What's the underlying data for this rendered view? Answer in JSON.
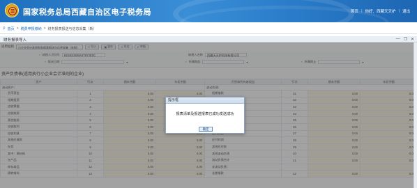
{
  "header": {
    "title": "国家税务总局西藏自治区电子税务局",
    "user_links": [
      "首页",
      "你好,",
      "西藏天天护",
      "退出"
    ]
  },
  "breadcrumb": {
    "home": "首页",
    "parent": "税费申报缴纳",
    "current": "财务报表报送与信息采集（新）"
  },
  "window": {
    "title": "财务报表导入",
    "controls": [
      "—",
      "❐",
      "✕"
    ]
  },
  "toolbar": {
    "period_label": "适用准则",
    "period_value": "小企业会计准则财务报表报送与信息采集（年报）",
    "buttons": [
      "导入",
      "暂存",
      "导出",
      "申报"
    ]
  },
  "form": {
    "taxpayer_id_label": "纳税人识别号",
    "taxpayer_id_value": "91540100MA6T8Y2E0C",
    "taxpayer_name_label": "纳税人名称",
    "taxpayer_name_value": "西藏天天护科技有限公司",
    "start_label": "报送日期",
    "start_value": "",
    "period_start_label": "所属期起",
    "period_start_value": "",
    "period_end_label": "所属期止",
    "period_end_value": ""
  },
  "section_title": "资产负债表(适用执行小企业会计准则的企业)",
  "table": {
    "headers": [
      "资产",
      "行次",
      "期末余额",
      "年初余额",
      "负债和所有者权益",
      "行次",
      "期末余额",
      "年初余额"
    ],
    "group_label": "流动资产：",
    "group_label_right": "流动负债：",
    "rows": [
      [
        "货币资金",
        "1",
        "0.00",
        "0.00",
        "短期借款",
        "31",
        "0.00",
        "0.00"
      ],
      [
        "短期投资",
        "2",
        "0.00",
        "0.00",
        "应付票据",
        "32",
        "0.00",
        "0.00"
      ],
      [
        "应收票据",
        "3",
        "0.00",
        "0.00",
        "应付账款",
        "33",
        "0.00",
        "0.00"
      ],
      [
        "应收账款",
        "4",
        "0.00",
        "0.00",
        "预收账款",
        "34",
        "0.00",
        "0.00"
      ],
      [
        "预付账款",
        "5",
        "0.00",
        "0.00",
        "应付职工薪酬",
        "35",
        "0.00",
        "0.00"
      ],
      [
        "应收股利",
        "6",
        "0.00",
        "0.00",
        "应交税费",
        "36",
        "0.00",
        "0.00"
      ],
      [
        "应收利息",
        "7",
        "0.00",
        "0.00",
        "应付利息",
        "37",
        "0.00",
        "0.00"
      ],
      [
        "其他应收款",
        "8",
        "0.00",
        "0.00",
        "应付利润",
        "38",
        "0.00",
        "0.00"
      ],
      [
        "存货",
        "9",
        "0.00",
        "0.00",
        "其他应付款",
        "39",
        "0.00",
        "0.00"
      ],
      [
        "其中：原材料",
        "10",
        "0.00",
        "0.00",
        "其他流动负债",
        "40",
        "0.00",
        "0.00"
      ],
      [
        "在产品",
        "11",
        "0.00",
        "0.00",
        "流动负债合计",
        "41",
        "0.00",
        "0.00"
      ],
      [
        "库存商品",
        "12",
        "0.00",
        "0.00",
        "非流动负债：",
        "",
        "",
        ""
      ],
      [
        "周转材料",
        "13",
        "0.00",
        "0.00",
        "长期借款",
        "42",
        "0.00",
        "0.00"
      ]
    ]
  },
  "dialog": {
    "title": "提示框",
    "message": "报表清单及报送报表已成功发送成功",
    "ok_label": "确定"
  }
}
